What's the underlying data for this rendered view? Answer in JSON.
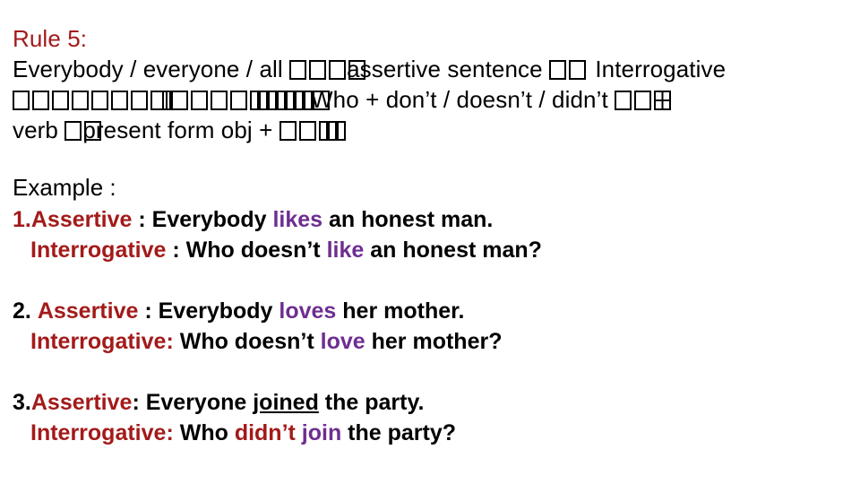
{
  "colors": {
    "red": "#A31A1A",
    "purple": "#6E2E91",
    "black": "#000000",
    "background": "#FFFFFF"
  },
  "rule": {
    "title": "Rule 5:",
    "line2_a": "Everybody / everyone / all",
    "line2_b": "assertive sentence",
    "line2_c": "Interrogative",
    "line3_a": "Who + don’t / doesn’t / didn’t",
    "line4_a": "verb",
    "line4_b": "present form  obj +"
  },
  "examples_heading": "Example :",
  "examples": [
    {
      "number": "1.",
      "number_color": "#A31A1A",
      "assertive_label": "Assertive",
      "assertive_sep": " : ",
      "assertive_pre": "Everybody ",
      "assertive_verb": "likes",
      "assertive_post": " an honest man.",
      "interrogative_label": "Interrogative",
      "interrogative_sep": " : ",
      "interrogative_pre": "Who doesn’t ",
      "interrogative_verb": "like",
      "interrogative_post": " an honest man?"
    },
    {
      "number": "2.",
      "number_color": "#000000",
      "assertive_label": "Assertive",
      "assertive_sep": " : ",
      "assertive_pre": "Everybody ",
      "assertive_verb": "loves",
      "assertive_post": " her mother.",
      "interrogative_label": "Interrogative",
      "interrogative_sep": ": ",
      "interrogative_pre": "Who doesn’t ",
      "interrogative_verb": "love",
      "interrogative_post": " her mother?"
    },
    {
      "number": "3.",
      "number_color": "#000000",
      "assertive_label": "Assertive",
      "assertive_sep": ": ",
      "assertive_pre": "Everyone ",
      "assertive_verb": "joined",
      "assertive_post": " the party.",
      "interrogative_label": "Interrogative",
      "interrogative_sep": ": ",
      "interrogative_pre": "Who ",
      "interrogative_aux": "didn’t",
      "interrogative_verb": "join",
      "interrogative_post": " the party?"
    }
  ]
}
